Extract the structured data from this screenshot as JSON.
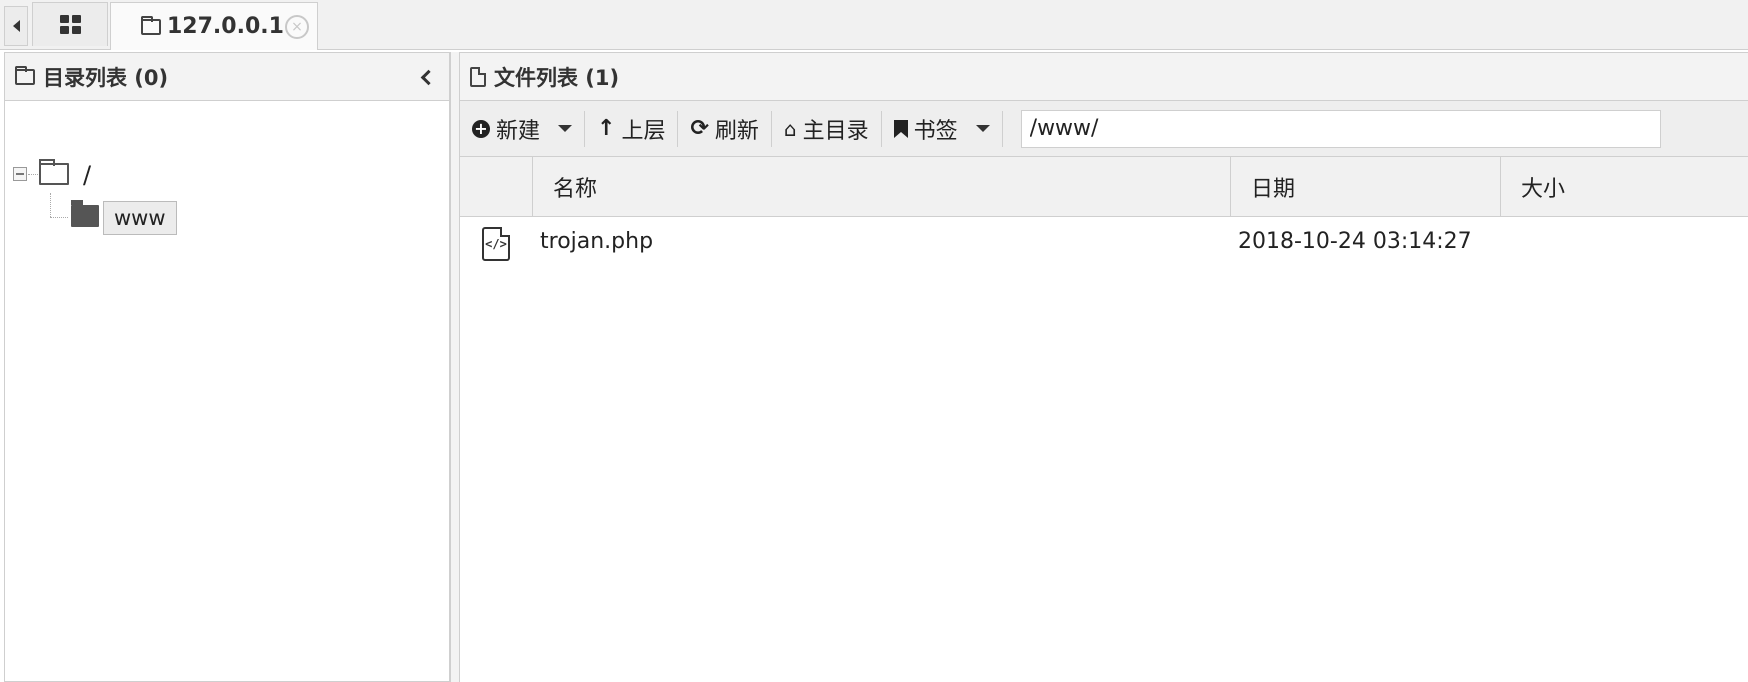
{
  "tabs": {
    "home_icon": "grid-icon",
    "host_tab": {
      "icon": "folder-icon",
      "label": "127.0.0.1",
      "close_symbol": "×"
    }
  },
  "left_panel": {
    "title": "目录列表 (0)",
    "tree": {
      "root_label": "/",
      "children": [
        {
          "label": "www"
        }
      ]
    }
  },
  "right_panel": {
    "title": "文件列表 (1)",
    "toolbar": {
      "new_label": "新建",
      "up_label": "上层",
      "refresh_label": "刷新",
      "home_label": "主目录",
      "bookmark_label": "书签",
      "path_value": "/www/"
    },
    "columns": [
      "名称",
      "日期",
      "大小"
    ],
    "files": [
      {
        "icon": "code-file-icon",
        "name": "trojan.php",
        "date": "2018-10-24 03:14:27"
      }
    ]
  }
}
